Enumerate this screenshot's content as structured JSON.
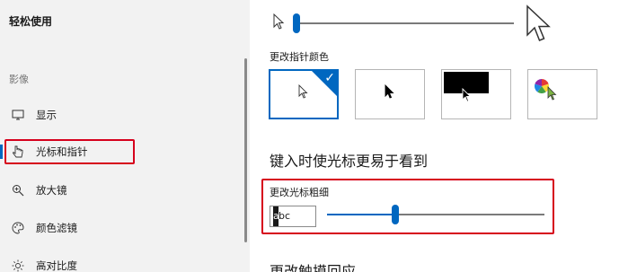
{
  "sidebar": {
    "title": "轻松使用",
    "section_label": "影像",
    "items": [
      {
        "label": "显示",
        "icon": "monitor-icon"
      },
      {
        "label": "光标和指针",
        "icon": "pointer-hand-icon",
        "active": true
      },
      {
        "label": "放大镜",
        "icon": "magnifier-icon"
      },
      {
        "label": "颜色滤镜",
        "icon": "palette-icon"
      },
      {
        "label": "高对比度",
        "icon": "contrast-sun-icon"
      }
    ]
  },
  "main": {
    "pointer_size": {
      "level": 0.02
    },
    "change_color_label": "更改指针颜色",
    "color_options": [
      {
        "name": "white",
        "selected": true
      },
      {
        "name": "black",
        "selected": false
      },
      {
        "name": "inverted",
        "selected": false
      },
      {
        "name": "custom",
        "selected": false
      }
    ],
    "heading": "键入时使光标更易于看到",
    "thickness": {
      "label": "更改光标粗细",
      "preview_text_caret": "a",
      "preview_text_rest": "bc",
      "level": 0.32
    },
    "next_heading": "更改触摸回应"
  },
  "colors": {
    "accent": "#0067c0",
    "highlight": "#d6001c",
    "sidebar_bg": "#f2f2f2"
  }
}
